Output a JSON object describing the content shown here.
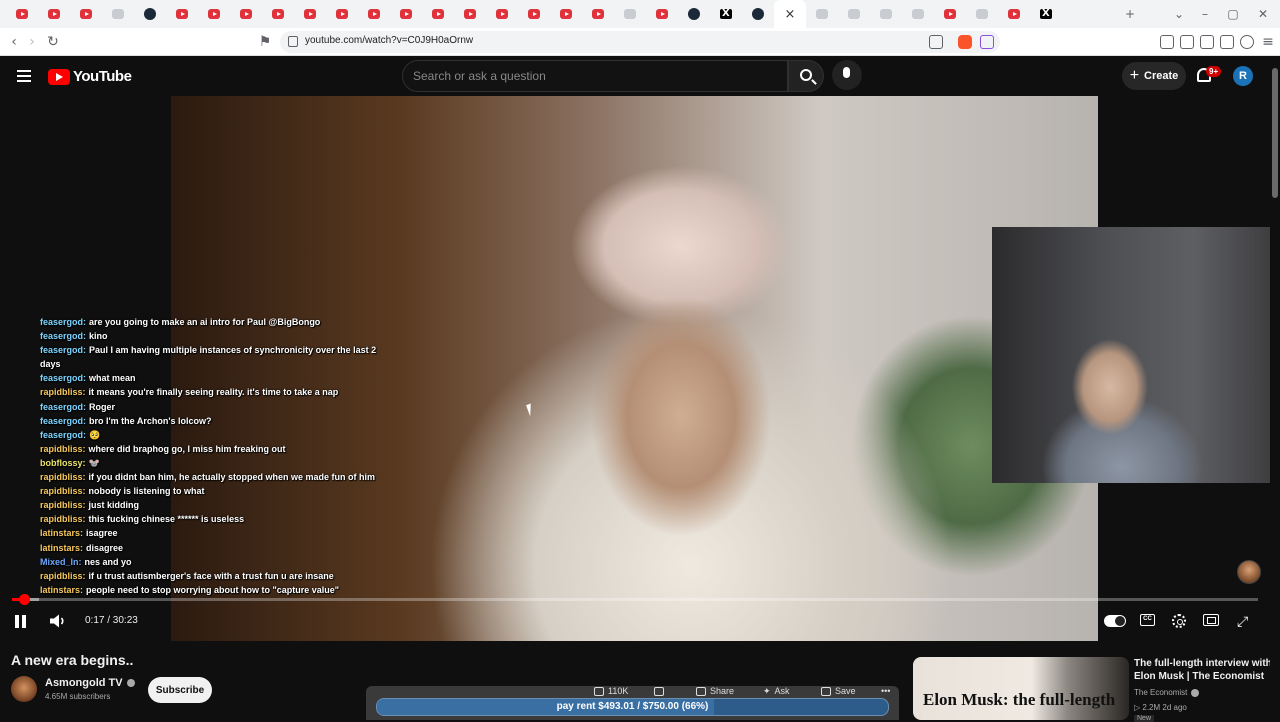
{
  "browser": {
    "url": "youtube.com/watch?v=C0J9H0aOrnw",
    "tabs": [
      "youtube",
      "youtube",
      "youtube",
      "reddit",
      "steam",
      "youtube",
      "youtube",
      "youtube",
      "youtube",
      "youtube",
      "youtube",
      "youtube",
      "youtube",
      "youtube",
      "youtube",
      "youtube",
      "youtube",
      "youtube",
      "youtube",
      "other",
      "youtube",
      "steam",
      "x",
      "steam",
      "active",
      "other",
      "other",
      "other",
      "other",
      "youtube",
      "other",
      "youtube",
      "x"
    ],
    "tab_close": "×",
    "new_tab": "+"
  },
  "yt": {
    "logo_text": "YouTube",
    "search_placeholder": "Search or ask a question",
    "create_label": "Create",
    "notif_badge": "9+",
    "avatar_letter": "R"
  },
  "player": {
    "chat": [
      {
        "user": "feasergod:",
        "color": "#7fd4ff",
        "text": "are you going to make an ai intro for Paul @BigBongo"
      },
      {
        "user": "feasergod:",
        "color": "#7fd4ff",
        "text": "kino"
      },
      {
        "user": "feasergod:",
        "color": "#7fd4ff",
        "text": "Paul I am having multiple instances of synchronicity over the last 2"
      },
      {
        "user": "",
        "color": "#7fd4ff",
        "text": "days"
      },
      {
        "user": "feasergod:",
        "color": "#7fd4ff",
        "text": "what mean"
      },
      {
        "user": "rapidbliss:",
        "color": "#f6c85f",
        "text": "it means you're finally seeing reality. it's time to take a nap"
      },
      {
        "user": "feasergod:",
        "color": "#7fd4ff",
        "text": "Roger"
      },
      {
        "user": "feasergod:",
        "color": "#7fd4ff",
        "text": "bro I'm the Archon's lolcow?"
      },
      {
        "user": "feasergod:",
        "color": "#7fd4ff",
        "text": "🥺"
      },
      {
        "user": "rapidbliss:",
        "color": "#f6c85f",
        "text": "where did braphog go, I miss him freaking out"
      },
      {
        "user": "bobflossy:",
        "color": "#e9e36b",
        "text": "🐭"
      },
      {
        "user": "rapidbliss:",
        "color": "#f6c85f",
        "text": "if you didnt ban him, he actually stopped when we made fun of him"
      },
      {
        "user": "rapidbliss:",
        "color": "#f6c85f",
        "text": "nobody is listening to what"
      },
      {
        "user": "rapidbliss:",
        "color": "#f6c85f",
        "text": "just kidding"
      },
      {
        "user": "rapidbliss:",
        "color": "#f6c85f",
        "text": "this fucking chinese ****** is useless"
      },
      {
        "user": "latinstars:",
        "color": "#f6c85f",
        "text": "isagree"
      },
      {
        "user": "latinstars:",
        "color": "#f6c85f",
        "text": "disagree"
      },
      {
        "user": "Mixed_In:",
        "color": "#6fa8ff",
        "text": "nes and yo"
      },
      {
        "user": "rapidbliss:",
        "color": "#f6c85f",
        "text": "if u trust autismberger's face with a trust fun u are insane"
      },
      {
        "user": "latinstars:",
        "color": "#f6c85f",
        "text": "people need to stop worrying about how to \"capture value\""
      }
    ],
    "time_display": "0:17 / 30:23",
    "progress_fraction": 0.0093,
    "buffer_fraction": 0.022
  },
  "video": {
    "title": "A new era begins..",
    "channel": "Asmongold TV",
    "subscribers": "4.65M subscribers",
    "subscribe_label": "Subscribe",
    "actions": {
      "likes": "110K",
      "share": "Share",
      "ask": "Ask",
      "save": "Save",
      "more": "•••"
    },
    "donation": {
      "text": "pay rent $493.01 / $750.00 (66%)",
      "fraction": 0.66
    }
  },
  "recommended": {
    "thumb_text": "Elon Musk: the full-length",
    "title": "The full-length interview with Elon Musk | The Economist",
    "channel": "The Economist",
    "meta": "▷ 2.2M   2d ago",
    "badge": "New"
  }
}
